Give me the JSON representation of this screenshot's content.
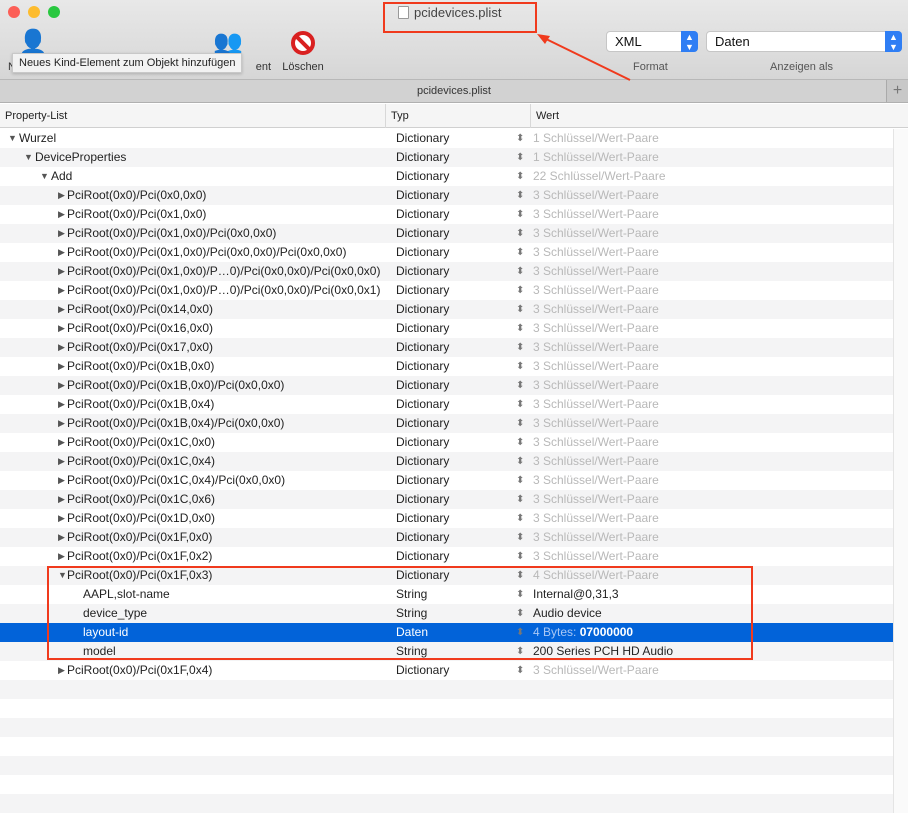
{
  "window": {
    "title": "pcidevices.plist",
    "tab": "pcidevices.plist"
  },
  "toolbar": {
    "new_item": "N",
    "new_child": "ent",
    "delete": "Löschen",
    "tooltip": "Neues Kind-Element zum Objekt hinzufügen",
    "format_value": "XML",
    "format_label": "Format",
    "view_value": "Daten",
    "view_label": "Anzeigen als"
  },
  "columns": {
    "key": "Property-List",
    "type": "Typ",
    "value": "Wert"
  },
  "rows": [
    {
      "key": "Wurzel",
      "type": "Dictionary",
      "value": "1 Schlüssel/Wert-Paare",
      "level": 0,
      "expand": "open",
      "muted": true
    },
    {
      "key": "DeviceProperties",
      "type": "Dictionary",
      "value": "1 Schlüssel/Wert-Paare",
      "level": 1,
      "expand": "open",
      "muted": true
    },
    {
      "key": "Add",
      "type": "Dictionary",
      "value": "22 Schlüssel/Wert-Paare",
      "level": 2,
      "expand": "open",
      "muted": true
    },
    {
      "key": "PciRoot(0x0)/Pci(0x0,0x0)",
      "type": "Dictionary",
      "value": "3 Schlüssel/Wert-Paare",
      "level": 3,
      "expand": "closed",
      "muted": true
    },
    {
      "key": "PciRoot(0x0)/Pci(0x1,0x0)",
      "type": "Dictionary",
      "value": "3 Schlüssel/Wert-Paare",
      "level": 3,
      "expand": "closed",
      "muted": true
    },
    {
      "key": "PciRoot(0x0)/Pci(0x1,0x0)/Pci(0x0,0x0)",
      "type": "Dictionary",
      "value": "3 Schlüssel/Wert-Paare",
      "level": 3,
      "expand": "closed",
      "muted": true
    },
    {
      "key": "PciRoot(0x0)/Pci(0x1,0x0)/Pci(0x0,0x0)/Pci(0x0,0x0)",
      "type": "Dictionary",
      "value": "3 Schlüssel/Wert-Paare",
      "level": 3,
      "expand": "closed",
      "muted": true
    },
    {
      "key": "PciRoot(0x0)/Pci(0x1,0x0)/P…0)/Pci(0x0,0x0)/Pci(0x0,0x0)",
      "type": "Dictionary",
      "value": "3 Schlüssel/Wert-Paare",
      "level": 3,
      "expand": "closed",
      "muted": true
    },
    {
      "key": "PciRoot(0x0)/Pci(0x1,0x0)/P…0)/Pci(0x0,0x0)/Pci(0x0,0x1)",
      "type": "Dictionary",
      "value": "3 Schlüssel/Wert-Paare",
      "level": 3,
      "expand": "closed",
      "muted": true
    },
    {
      "key": "PciRoot(0x0)/Pci(0x14,0x0)",
      "type": "Dictionary",
      "value": "3 Schlüssel/Wert-Paare",
      "level": 3,
      "expand": "closed",
      "muted": true
    },
    {
      "key": "PciRoot(0x0)/Pci(0x16,0x0)",
      "type": "Dictionary",
      "value": "3 Schlüssel/Wert-Paare",
      "level": 3,
      "expand": "closed",
      "muted": true
    },
    {
      "key": "PciRoot(0x0)/Pci(0x17,0x0)",
      "type": "Dictionary",
      "value": "3 Schlüssel/Wert-Paare",
      "level": 3,
      "expand": "closed",
      "muted": true
    },
    {
      "key": "PciRoot(0x0)/Pci(0x1B,0x0)",
      "type": "Dictionary",
      "value": "3 Schlüssel/Wert-Paare",
      "level": 3,
      "expand": "closed",
      "muted": true
    },
    {
      "key": "PciRoot(0x0)/Pci(0x1B,0x0)/Pci(0x0,0x0)",
      "type": "Dictionary",
      "value": "3 Schlüssel/Wert-Paare",
      "level": 3,
      "expand": "closed",
      "muted": true
    },
    {
      "key": "PciRoot(0x0)/Pci(0x1B,0x4)",
      "type": "Dictionary",
      "value": "3 Schlüssel/Wert-Paare",
      "level": 3,
      "expand": "closed",
      "muted": true
    },
    {
      "key": "PciRoot(0x0)/Pci(0x1B,0x4)/Pci(0x0,0x0)",
      "type": "Dictionary",
      "value": "3 Schlüssel/Wert-Paare",
      "level": 3,
      "expand": "closed",
      "muted": true
    },
    {
      "key": "PciRoot(0x0)/Pci(0x1C,0x0)",
      "type": "Dictionary",
      "value": "3 Schlüssel/Wert-Paare",
      "level": 3,
      "expand": "closed",
      "muted": true
    },
    {
      "key": "PciRoot(0x0)/Pci(0x1C,0x4)",
      "type": "Dictionary",
      "value": "3 Schlüssel/Wert-Paare",
      "level": 3,
      "expand": "closed",
      "muted": true
    },
    {
      "key": "PciRoot(0x0)/Pci(0x1C,0x4)/Pci(0x0,0x0)",
      "type": "Dictionary",
      "value": "3 Schlüssel/Wert-Paare",
      "level": 3,
      "expand": "closed",
      "muted": true
    },
    {
      "key": "PciRoot(0x0)/Pci(0x1C,0x6)",
      "type": "Dictionary",
      "value": "3 Schlüssel/Wert-Paare",
      "level": 3,
      "expand": "closed",
      "muted": true
    },
    {
      "key": "PciRoot(0x0)/Pci(0x1D,0x0)",
      "type": "Dictionary",
      "value": "3 Schlüssel/Wert-Paare",
      "level": 3,
      "expand": "closed",
      "muted": true
    },
    {
      "key": "PciRoot(0x0)/Pci(0x1F,0x0)",
      "type": "Dictionary",
      "value": "3 Schlüssel/Wert-Paare",
      "level": 3,
      "expand": "closed",
      "muted": true
    },
    {
      "key": "PciRoot(0x0)/Pci(0x1F,0x2)",
      "type": "Dictionary",
      "value": "3 Schlüssel/Wert-Paare",
      "level": 3,
      "expand": "closed",
      "muted": true
    },
    {
      "key": "PciRoot(0x0)/Pci(0x1F,0x3)",
      "type": "Dictionary",
      "value": "4 Schlüssel/Wert-Paare",
      "level": 3,
      "expand": "open",
      "muted": true
    },
    {
      "key": "AAPL,slot-name",
      "type": "String",
      "value": "Internal@0,31,3",
      "level": 4
    },
    {
      "key": "device_type",
      "type": "String",
      "value": "Audio device",
      "level": 4
    },
    {
      "key": "layout-id",
      "type": "Daten",
      "value_prefix": "4 Bytes:",
      "value": "07000000",
      "level": 4,
      "selected": true
    },
    {
      "key": "model",
      "type": "String",
      "value": "200 Series PCH HD Audio",
      "level": 4
    },
    {
      "key": "PciRoot(0x0)/Pci(0x1F,0x4)",
      "type": "Dictionary",
      "value": "3 Schlüssel/Wert-Paare",
      "level": 3,
      "expand": "closed",
      "muted": true
    }
  ],
  "colors": {
    "selection": "#0263d9",
    "annotation": "#f03a1d"
  }
}
